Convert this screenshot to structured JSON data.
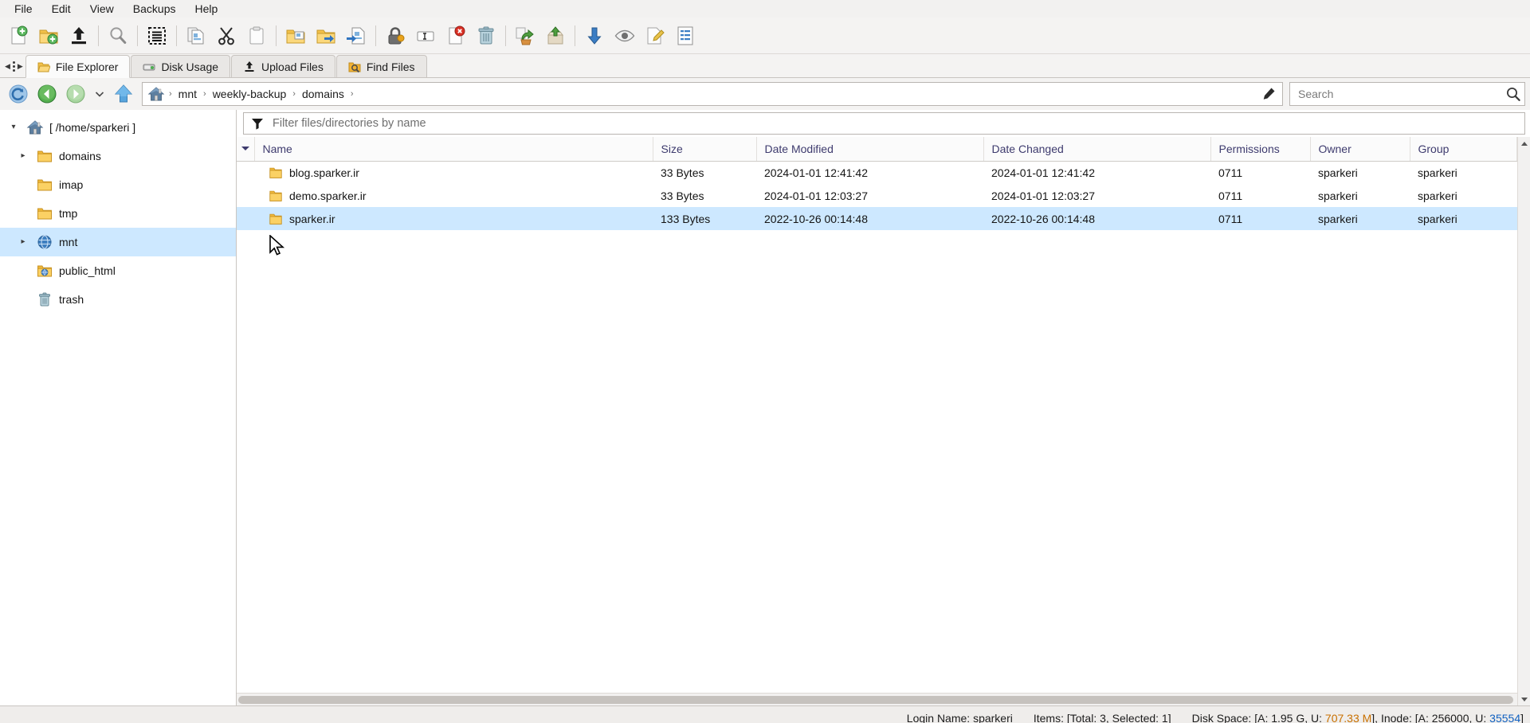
{
  "menubar": {
    "items": [
      {
        "label": "File"
      },
      {
        "label": "Edit"
      },
      {
        "label": "View"
      },
      {
        "label": "Backups"
      },
      {
        "label": "Help"
      }
    ]
  },
  "toolbar": {
    "buttons": [
      {
        "name": "new-file",
        "icon": "new-file-icon",
        "title": "New File"
      },
      {
        "name": "new-folder",
        "icon": "new-folder-icon",
        "title": "New Folder"
      },
      {
        "name": "upload",
        "icon": "upload-icon",
        "title": "Upload"
      },
      {
        "sep": true
      },
      {
        "name": "search",
        "icon": "magnifier-icon",
        "title": "Search"
      },
      {
        "sep": true
      },
      {
        "name": "select-all",
        "icon": "select-all-icon",
        "title": "Select All"
      },
      {
        "sep": true
      },
      {
        "name": "copy",
        "icon": "copy-icon",
        "title": "Copy"
      },
      {
        "name": "cut",
        "icon": "scissors-icon",
        "title": "Cut"
      },
      {
        "name": "paste",
        "icon": "clipboard-icon",
        "title": "Paste"
      },
      {
        "sep": true
      },
      {
        "name": "move-file",
        "icon": "folder-move-icon",
        "title": "Move File"
      },
      {
        "name": "extract",
        "icon": "folder-in-icon",
        "title": "Extract"
      },
      {
        "name": "compress",
        "icon": "file-out-icon",
        "title": "Compress"
      },
      {
        "sep": true
      },
      {
        "name": "permissions",
        "icon": "lock-icon",
        "title": "Permissions"
      },
      {
        "name": "rename",
        "icon": "rename-icon",
        "title": "Rename"
      },
      {
        "name": "delete-file",
        "icon": "file-delete-icon",
        "title": "Delete"
      },
      {
        "name": "trash",
        "icon": "trash-icon",
        "title": "Trash"
      },
      {
        "sep": true
      },
      {
        "name": "restore",
        "icon": "restore-icon",
        "title": "Restore"
      },
      {
        "name": "archive",
        "icon": "archive-icon",
        "title": "Archive"
      },
      {
        "sep": true
      },
      {
        "name": "download",
        "icon": "download-arrow-icon",
        "title": "Download"
      },
      {
        "name": "view",
        "icon": "eye-icon",
        "title": "View"
      },
      {
        "name": "edit",
        "icon": "pencil-file-icon",
        "title": "Edit"
      },
      {
        "name": "properties",
        "icon": "properties-icon",
        "title": "Properties"
      }
    ]
  },
  "tabs": [
    {
      "label": "File Explorer",
      "icon": "folder-open-icon",
      "active": true
    },
    {
      "label": "Disk Usage",
      "icon": "disk-icon",
      "active": false
    },
    {
      "label": "Upload Files",
      "icon": "upload-icon",
      "active": false
    },
    {
      "label": "Find Files",
      "icon": "find-icon",
      "active": false
    }
  ],
  "nav": {
    "refresh_title": "Refresh",
    "back_title": "Back",
    "forward_title": "Forward",
    "history_title": "History",
    "up_title": "Up One Level",
    "breadcrumb": [
      "mnt",
      "weekly-backup",
      "domains"
    ],
    "separator": "›",
    "edit_path_title": "Edit Path"
  },
  "search": {
    "value": "",
    "placeholder": "Search"
  },
  "filter": {
    "value": "",
    "placeholder": "Filter files/directories by name"
  },
  "sidebar": {
    "items": [
      {
        "label": "[ /home/sparkeri ]",
        "icon": "home-root-icon",
        "indent": 0,
        "twisty": "down",
        "selected": false
      },
      {
        "label": "domains",
        "icon": "folder-icon",
        "indent": 1,
        "twisty": "right",
        "selected": false
      },
      {
        "label": "imap",
        "icon": "folder-icon",
        "indent": 1,
        "twisty": "none",
        "selected": false
      },
      {
        "label": "tmp",
        "icon": "folder-icon",
        "indent": 1,
        "twisty": "none",
        "selected": false
      },
      {
        "label": "mnt",
        "icon": "mount-icon",
        "indent": 1,
        "twisty": "right",
        "selected": true
      },
      {
        "label": "public_html",
        "icon": "public-html-icon",
        "indent": 1,
        "twisty": "none",
        "selected": false
      },
      {
        "label": "trash",
        "icon": "trash-icon",
        "indent": 1,
        "twisty": "none",
        "selected": false
      }
    ]
  },
  "filelist": {
    "columns": [
      "Name",
      "Size",
      "Date Modified",
      "Date Changed",
      "Permissions",
      "Owner",
      "Group"
    ],
    "rows": [
      {
        "icon": "folder-icon",
        "name": "blog.sparker.ir",
        "size": "33 Bytes",
        "modified": "2024-01-01 12:41:42",
        "changed": "2024-01-01 12:41:42",
        "permissions": "0711",
        "owner": "sparkeri",
        "group": "sparkeri",
        "selected": false
      },
      {
        "icon": "folder-icon",
        "name": "demo.sparker.ir",
        "size": "33 Bytes",
        "modified": "2024-01-01 12:03:27",
        "changed": "2024-01-01 12:03:27",
        "permissions": "0711",
        "owner": "sparkeri",
        "group": "sparkeri",
        "selected": false
      },
      {
        "icon": "folder-icon",
        "name": "sparker.ir",
        "size": "133 Bytes",
        "modified": "2022-10-26 00:14:48",
        "changed": "2022-10-26 00:14:48",
        "permissions": "0711",
        "owner": "sparkeri",
        "group": "sparkeri",
        "selected": true
      }
    ]
  },
  "statusbar": {
    "login": "Login Name: sparkeri",
    "items": "Items: [Total: 3, Selected: 1]",
    "disk_prefix": "Disk Space: [A: 1.95 G, U: ",
    "disk_used": "707.33 M",
    "disk_mid": "], Inode: [A: 256000, U: ",
    "inode_used": "35554",
    "disk_suffix": "]"
  },
  "colors": {
    "accent_selection": "#cde8ff",
    "header_text": "#3e3b6e",
    "status_orange": "#c87000",
    "status_blue": "#1060c0",
    "folder_yellow": "#f3c14a"
  }
}
